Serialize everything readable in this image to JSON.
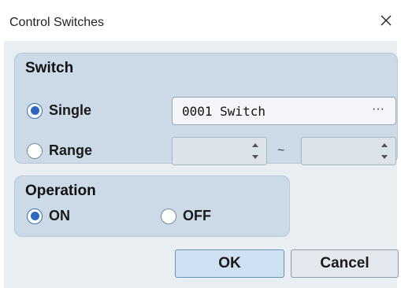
{
  "window": {
    "title": "Control Switches",
    "close_icon": "close-icon"
  },
  "switch_group": {
    "title": "Switch",
    "single": {
      "label": "Single",
      "checked": true
    },
    "range": {
      "label": "Range",
      "checked": false
    },
    "switch_value": "0001 Switch",
    "browse_glyph": "···",
    "range_separator": "~"
  },
  "operation_group": {
    "title": "Operation",
    "on": {
      "label": "ON",
      "checked": true
    },
    "off": {
      "label": "OFF",
      "checked": false
    }
  },
  "buttons": {
    "ok": "OK",
    "cancel": "Cancel"
  },
  "colors": {
    "accent": "#2f67c4",
    "group_bg": "#ccd9e7",
    "panel_bg": "#e9eef3"
  }
}
